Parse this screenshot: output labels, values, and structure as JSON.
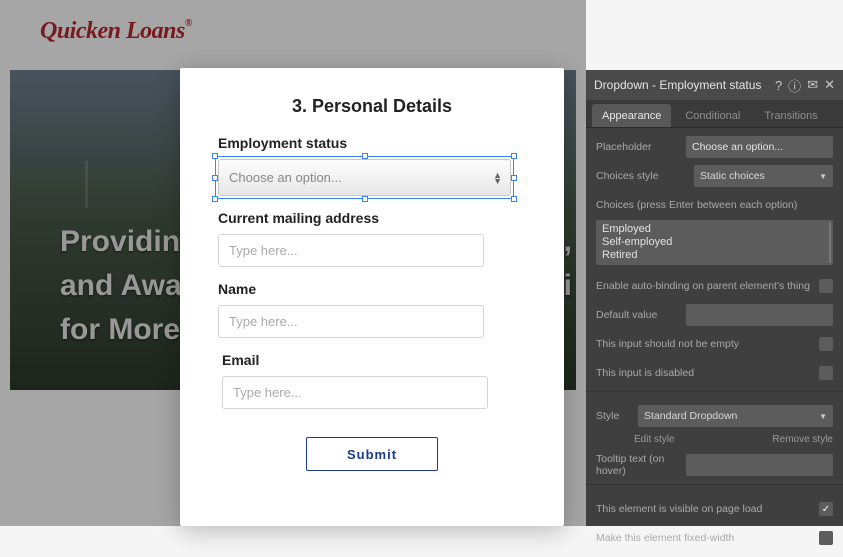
{
  "brand": "Quicken Loans",
  "hero": {
    "line1": "Providin",
    "line2": "and Awa",
    "line3": "for More",
    "tail1": "s,",
    "tail2": "vi"
  },
  "modal": {
    "title": "3. Personal Details",
    "employment_label": "Employment status",
    "employment_placeholder": "Choose an option...",
    "address_label": "Current mailing address",
    "address_placeholder": "Type here...",
    "name_label": "Name",
    "name_placeholder": "Type here...",
    "email_label": "Email",
    "email_placeholder": "Type here...",
    "submit_label": "Submit"
  },
  "inspector": {
    "title": "Dropdown - Employment status",
    "tabs": {
      "appearance": "Appearance",
      "conditional": "Conditional",
      "transitions": "Transitions"
    },
    "placeholder_label": "Placeholder",
    "placeholder_value": "Choose an option...",
    "choices_style_label": "Choices style",
    "choices_style_value": "Static choices",
    "choices_label": "Choices (press Enter between each option)",
    "choices": [
      "Employed",
      "Self-employed",
      "Retired"
    ],
    "autobind_label": "Enable auto-binding on parent element's thing",
    "default_label": "Default value",
    "not_empty_label": "This input should not be empty",
    "disabled_label": "This input is disabled",
    "style_label": "Style",
    "style_value": "Standard Dropdown",
    "edit_style": "Edit style",
    "remove_style": "Remove style",
    "tooltip_label": "Tooltip text (on hover)",
    "visible_label": "This element is visible on page load",
    "fixed_width_label": "Make this element fixed-width"
  }
}
